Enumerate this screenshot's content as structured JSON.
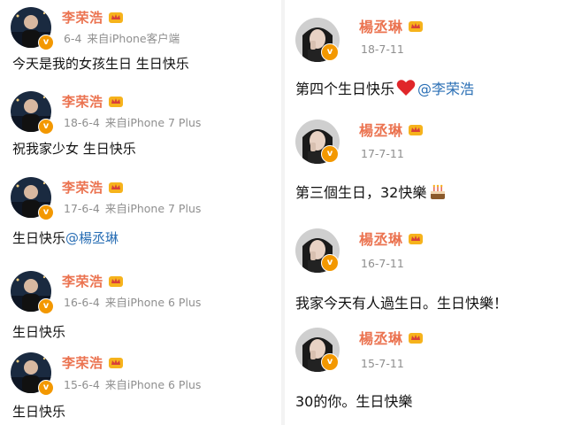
{
  "left_column": {
    "posts": [
      {
        "user": "李荣浩",
        "date": "6-4",
        "source": "来自iPhone客户端",
        "text": "今天是我的女孩生日 生日快乐",
        "mention": ""
      },
      {
        "user": "李荣浩",
        "date": "18-6-4",
        "source": "来自iPhone 7 Plus",
        "text": "祝我家少女 生日快乐",
        "mention": ""
      },
      {
        "user": "李荣浩",
        "date": "17-6-4",
        "source": "来自iPhone 7 Plus",
        "text": "生日快乐",
        "mention": "@楊丞琳"
      },
      {
        "user": "李荣浩",
        "date": "16-6-4",
        "source": "来自iPhone 6 Plus",
        "text": "生日快乐",
        "mention": ""
      },
      {
        "user": "李荣浩",
        "date": "15-6-4",
        "source": "来自iPhone 6 Plus",
        "text": "生日快乐",
        "mention": ""
      }
    ]
  },
  "right_column": {
    "posts": [
      {
        "user": "楊丞琳",
        "date": "18-7-11",
        "text": "第四个生日快乐",
        "emoji": "heart",
        "mention": "@李荣浩"
      },
      {
        "user": "楊丞琳",
        "date": "17-7-11",
        "text": "第三個生日，32快樂",
        "emoji": "cake",
        "mention": ""
      },
      {
        "user": "楊丞琳",
        "date": "16-7-11",
        "text": "我家今天有人過生日。生日快樂！",
        "emoji": "",
        "mention": ""
      },
      {
        "user": "楊丞琳",
        "date": "15-7-11",
        "text": "30的你。生日快樂",
        "emoji": "",
        "mention": ""
      }
    ]
  },
  "badge_letter": "v",
  "colors": {
    "username": "#eb7350",
    "mention": "#2a6fb5",
    "meta": "#8f8f8f",
    "badge": "#f39800",
    "heart": "#e0262a"
  },
  "icons": {
    "verified": "verified-badge-icon",
    "crown": "crown-icon",
    "heart": "heart-icon",
    "cake": "birthday-cake-icon"
  }
}
